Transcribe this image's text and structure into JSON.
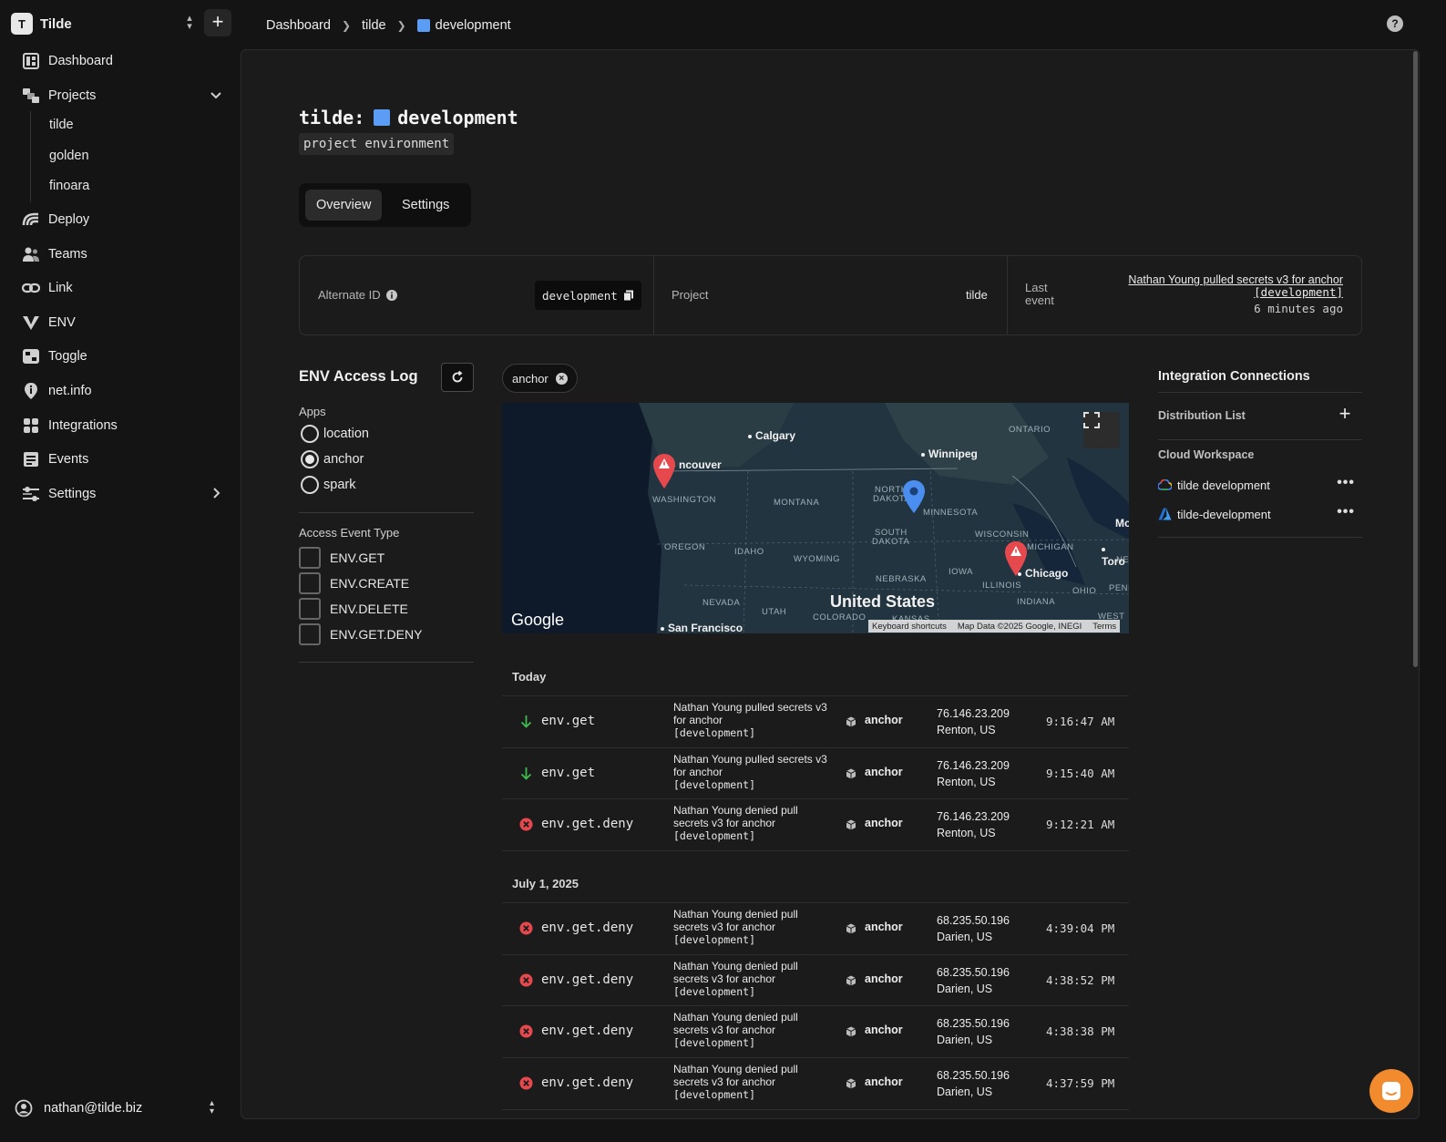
{
  "workspace": {
    "initial": "T",
    "name": "Tilde"
  },
  "nav": {
    "dashboard": "Dashboard",
    "projects": "Projects",
    "project_items": [
      "tilde",
      "golden",
      "finoara"
    ],
    "deploy": "Deploy",
    "teams": "Teams",
    "link": "Link",
    "env": "ENV",
    "toggle": "Toggle",
    "netinfo": "net.info",
    "integrations": "Integrations",
    "events": "Events",
    "settings": "Settings"
  },
  "user": {
    "email": "nathan@tilde.biz"
  },
  "breadcrumb": [
    "Dashboard",
    "tilde",
    "development"
  ],
  "page": {
    "title_prefix": "tilde:",
    "title_env": "development",
    "subtitle": "project environment",
    "env_color": "#5b9cf5"
  },
  "tabs": [
    "Overview",
    "Settings"
  ],
  "info": {
    "alt_id_label": "Alternate ID",
    "alt_id_value": "development",
    "project_label": "Project",
    "project_value": "tilde",
    "last_event_label_1": "Last",
    "last_event_label_2": "event",
    "last_event_text_1": "Nathan Young pulled secrets v3 for anchor",
    "last_event_text_2": "[development]",
    "last_event_time": "6 minutes ago"
  },
  "log": {
    "title": "ENV Access Log",
    "apps_label": "Apps",
    "apps": [
      {
        "label": "location",
        "selected": false
      },
      {
        "label": "anchor",
        "selected": true
      },
      {
        "label": "spark",
        "selected": false
      }
    ],
    "type_label": "Access Event Type",
    "types": [
      "ENV.GET",
      "ENV.CREATE",
      "ENV.DELETE",
      "ENV.GET.DENY"
    ],
    "active_filter": "anchor"
  },
  "map": {
    "regions": [
      "WASHINGTON",
      "MONTANA",
      "NORTH",
      "DAKOTA",
      "MINNESOTA",
      "ONTARIO",
      "OREGON",
      "IDAHO",
      "WYOMING",
      "SOUTH",
      "DAKOTA",
      "WISCONSIN",
      "MICHIGAN",
      "IOWA",
      "NEBRASKA",
      "ILLINOIS",
      "INDIANA",
      "OHIO",
      "NEVADA",
      "UTAH",
      "COLORADO",
      "KANSAS",
      "WEST",
      "NE",
      "PENI"
    ],
    "cities": [
      "Calgary",
      "Winnipeg",
      "ncouver",
      "Chicago",
      "San Francisco",
      "Toro",
      "Mo"
    ],
    "country": "United States",
    "logo": "Google",
    "attribution": [
      "Keyboard shortcuts",
      "Map Data ©2025 Google, INEGI",
      "Terms"
    ]
  },
  "groups": [
    {
      "label": "Today",
      "rows": [
        {
          "type": "env.get",
          "status": "ok",
          "desc": "Nathan Young pulled secrets v3 for anchor",
          "env": "[development]",
          "app": "anchor",
          "ip": "76.146.23.209",
          "loc": "Renton, US",
          "time": "9:16:47 AM"
        },
        {
          "type": "env.get",
          "status": "ok",
          "desc": "Nathan Young pulled secrets v3 for anchor",
          "env": "[development]",
          "app": "anchor",
          "ip": "76.146.23.209",
          "loc": "Renton, US",
          "time": "9:15:40 AM"
        },
        {
          "type": "env.get.deny",
          "status": "deny",
          "desc": "Nathan Young denied pull secrets v3 for anchor",
          "env": "[development]",
          "app": "anchor",
          "ip": "76.146.23.209",
          "loc": "Renton, US",
          "time": "9:12:21 AM"
        }
      ]
    },
    {
      "label": "July 1, 2025",
      "rows": [
        {
          "type": "env.get.deny",
          "status": "deny",
          "desc": "Nathan Young denied pull secrets v3 for anchor",
          "env": "[development]",
          "app": "anchor",
          "ip": "68.235.50.196",
          "loc": "Darien, US",
          "time": "4:39:04 PM"
        },
        {
          "type": "env.get.deny",
          "status": "deny",
          "desc": "Nathan Young denied pull secrets v3 for anchor",
          "env": "[development]",
          "app": "anchor",
          "ip": "68.235.50.196",
          "loc": "Darien, US",
          "time": "4:38:52 PM"
        },
        {
          "type": "env.get.deny",
          "status": "deny",
          "desc": "Nathan Young denied pull secrets v3 for anchor",
          "env": "[development]",
          "app": "anchor",
          "ip": "68.235.50.196",
          "loc": "Darien, US",
          "time": "4:38:38 PM"
        },
        {
          "type": "env.get.deny",
          "status": "deny",
          "desc": "Nathan Young denied pull secrets v3 for anchor",
          "env": "[development]",
          "app": "anchor",
          "ip": "68.235.50.196",
          "loc": "Darien, US",
          "time": "4:37:59 PM"
        }
      ]
    }
  ],
  "integrations": {
    "title": "Integration Connections",
    "distribution_label": "Distribution List",
    "cloud_label": "Cloud Workspace",
    "items": [
      {
        "label": "tilde development",
        "icon": "gcp-icon"
      },
      {
        "label": "tilde-development",
        "icon": "azure-icon"
      }
    ]
  },
  "colors": {
    "ok": "#3fb950",
    "deny": "#e5484d",
    "accent": "#5b9cf5",
    "chat": "#f28a2e"
  }
}
